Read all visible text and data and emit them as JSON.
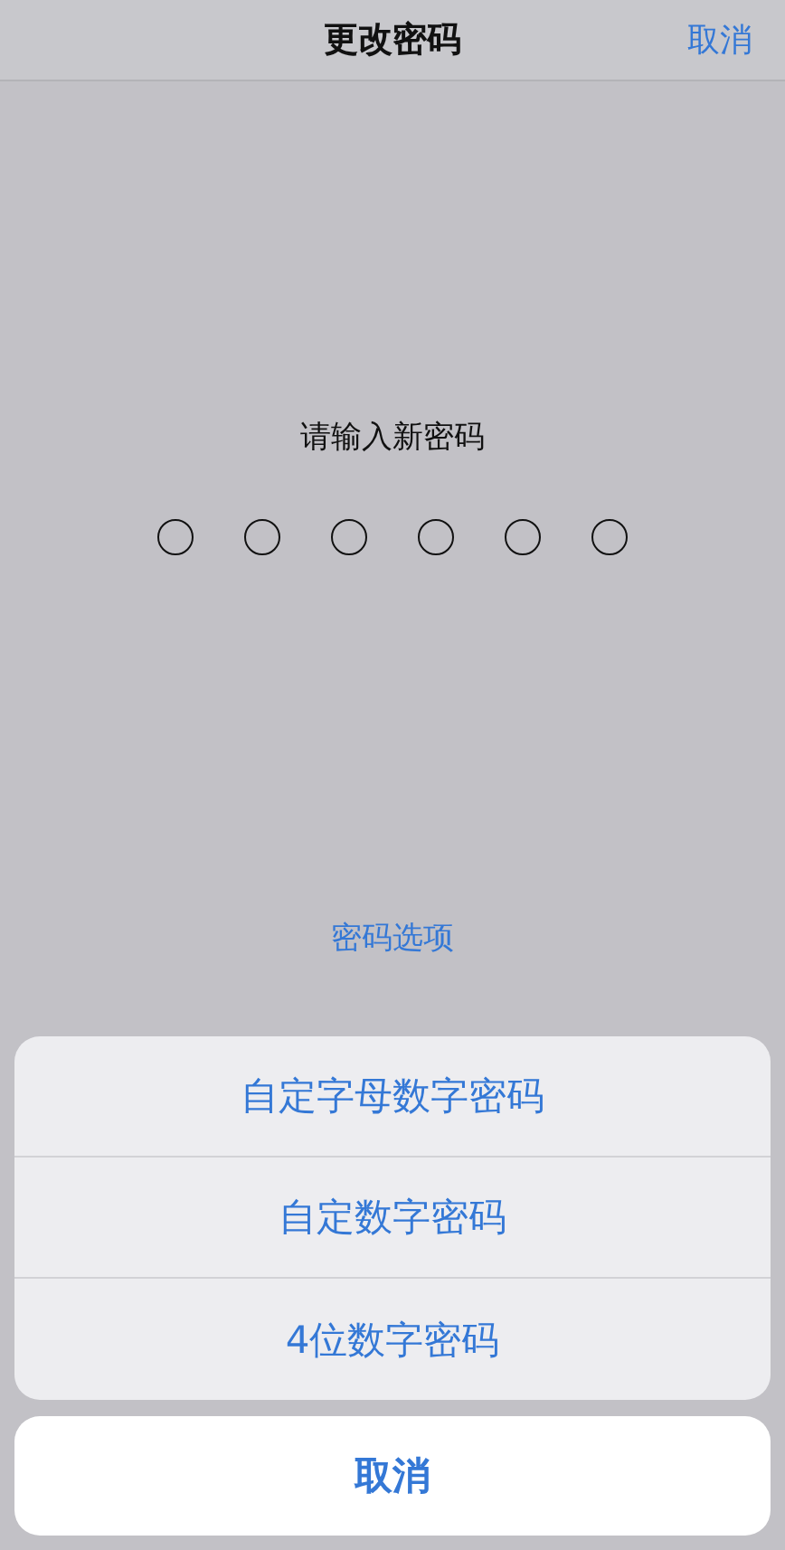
{
  "nav": {
    "title": "更改密码",
    "cancel": "取消"
  },
  "prompt": "请输入新密码",
  "passcode_dots": [
    {
      "filled": false
    },
    {
      "filled": false
    },
    {
      "filled": false
    },
    {
      "filled": false
    },
    {
      "filled": false
    },
    {
      "filled": false
    }
  ],
  "options_link": "密码选项",
  "action_sheet": {
    "options": [
      "自定字母数字密码",
      "自定数字密码",
      "4位数字密码"
    ],
    "cancel": "取消"
  }
}
